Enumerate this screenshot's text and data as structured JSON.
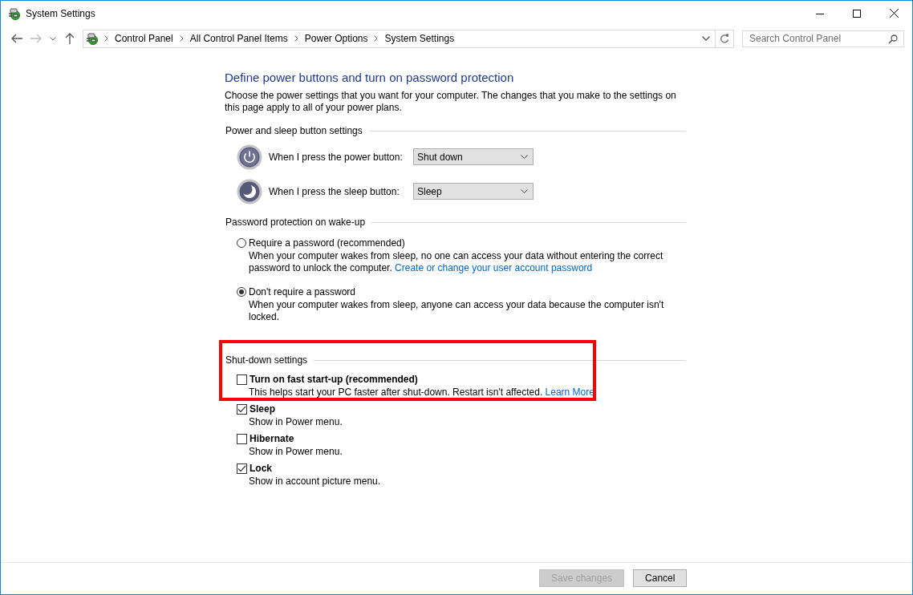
{
  "window": {
    "title": "System Settings"
  },
  "nav": {
    "breadcrumbs": [
      "Control Panel",
      "All Control Panel Items",
      "Power Options",
      "System Settings"
    ],
    "search": {
      "placeholder": "Search Control Panel"
    }
  },
  "page": {
    "heading": "Define power buttons and turn on password protection",
    "intro": "Choose the power settings that you want for your computer. The changes that you make to the settings on this page apply to all of your power plans."
  },
  "power_buttons": {
    "title": "Power and sleep button settings",
    "rows": [
      {
        "kind": "power",
        "label": "When I press the power button:",
        "value": "Shut down"
      },
      {
        "kind": "sleep",
        "label": "When I press the sleep button:",
        "value": "Sleep"
      }
    ]
  },
  "password": {
    "title": "Password protection on wake-up",
    "options": [
      {
        "label": "Require a password (recommended)",
        "description": "When your computer wakes from sleep, no one can access your data without entering the correct password to unlock the computer.",
        "link": "Create or change your user account password",
        "selected": false
      },
      {
        "label": "Don't require a password",
        "description": "When your computer wakes from sleep, anyone can access your data because the computer isn't locked.",
        "selected": true
      }
    ]
  },
  "shutdown": {
    "title": "Shut-down settings",
    "highlighted": true,
    "options": [
      {
        "label": "Turn on fast start-up (recommended)",
        "description": "This helps start your PC faster after shut-down. Restart isn't affected.",
        "link": "Learn More",
        "checked": false
      },
      {
        "label": "Sleep",
        "description": "Show in Power menu.",
        "checked": true
      },
      {
        "label": "Hibernate",
        "description": "Show in Power menu.",
        "checked": false
      },
      {
        "label": "Lock",
        "description": "Show in account picture menu.",
        "checked": true
      }
    ]
  },
  "buttons": [
    {
      "label": "Save changes",
      "disabled": true
    },
    {
      "label": "Cancel",
      "disabled": false
    }
  ]
}
